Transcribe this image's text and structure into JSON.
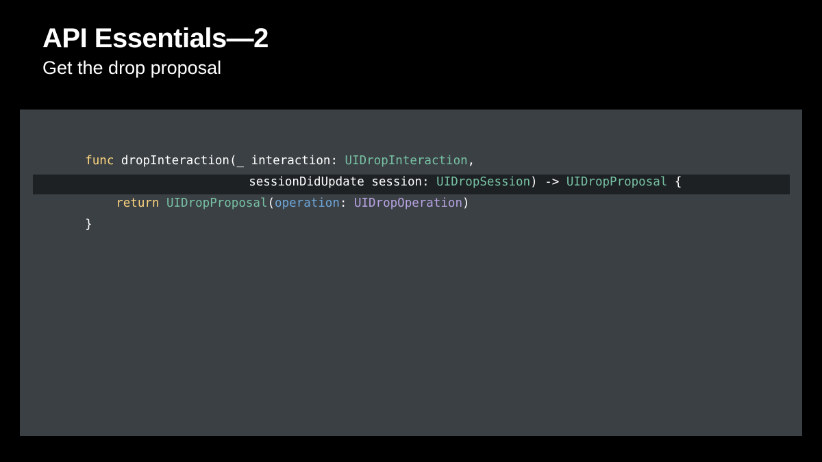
{
  "slide": {
    "title": "API Essentials—2",
    "subtitle": "Get the drop proposal"
  },
  "colors": {
    "background": "#000000",
    "code_panel": "#3b4044",
    "highlight_line": "#1d2124",
    "keyword": "#fcd57f",
    "type": "#78c2a4",
    "parameter": "#6fa8dc",
    "project_type": "#b8a4e3",
    "plain": "#ffffff"
  },
  "code": {
    "line1": {
      "kw_func": "func",
      "t1": " dropInteraction(_ interaction: ",
      "type1": "UIDropInteraction",
      "t2": ","
    },
    "line2": {
      "t1": "sessionDidUpdate session: ",
      "type1": "UIDropSession",
      "t2": ") -> ",
      "type2": "UIDropProposal",
      "t3": " {"
    },
    "line3": {
      "kw_return": "return",
      "t1": " ",
      "type1": "UIDropProposal",
      "t2": "(",
      "param": "operation",
      "t3": ": ",
      "type2": "UIDropOperation",
      "t4": ")"
    },
    "line4": {
      "t1": "}"
    }
  }
}
